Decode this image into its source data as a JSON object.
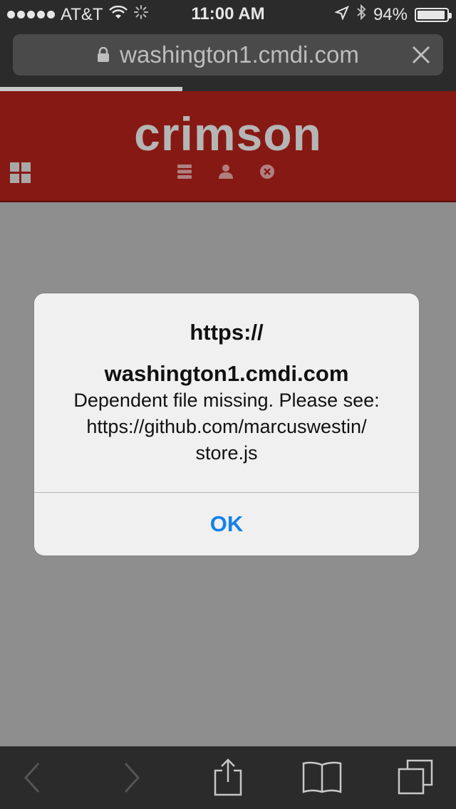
{
  "status_bar": {
    "carrier": "AT&T",
    "time": "11:00 AM",
    "battery_percent": "94%",
    "battery_level": 0.94,
    "signal_dots": 5
  },
  "browser": {
    "url": "washington1.cmdi.com",
    "load_progress": 0.4
  },
  "site": {
    "brand": "crimson",
    "header_color": "#861913"
  },
  "alert": {
    "title_line1": "https://",
    "title_line2": "washington1.cmdi.com",
    "message_line1": "Dependent file missing. Please see:",
    "message_line2": "https://github.com/marcuswestin/",
    "message_line3": "store.js",
    "ok_label": "OK",
    "button_color": "#1680e8"
  },
  "toolbar": {
    "icons": [
      "back-icon",
      "forward-icon",
      "share-icon",
      "bookmarks-icon",
      "tabs-icon"
    ]
  }
}
